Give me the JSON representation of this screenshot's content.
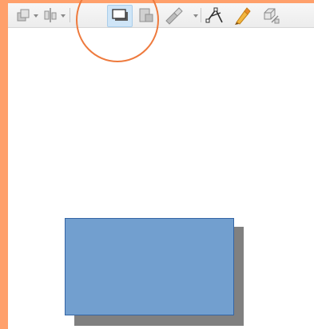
{
  "toolbar": {
    "buttons": [
      {
        "name": "bring-forward",
        "icon": "bring-forward-icon"
      },
      {
        "name": "align",
        "icon": "align-icon"
      },
      {
        "name": "shadow",
        "icon": "shadow-icon",
        "state": "active"
      },
      {
        "name": "crop",
        "icon": "crop-icon"
      },
      {
        "name": "transformations",
        "icon": "transformations-icon"
      },
      {
        "name": "points",
        "icon": "points-icon"
      },
      {
        "name": "glue-points",
        "icon": "glue-points-icon"
      },
      {
        "name": "toggle-extrusion",
        "icon": "extrusion-icon"
      }
    ]
  },
  "canvas": {
    "shape": {
      "type": "rectangle",
      "fill": "#729fcf",
      "border": "#3465a4",
      "shadow": true,
      "shadow_color": "#808080"
    }
  },
  "annotation": {
    "type": "circle",
    "color": "#ee7a3d",
    "target": "shadow"
  },
  "colors": {
    "frame": "#ffa06b",
    "toolbar": "#efefef"
  }
}
